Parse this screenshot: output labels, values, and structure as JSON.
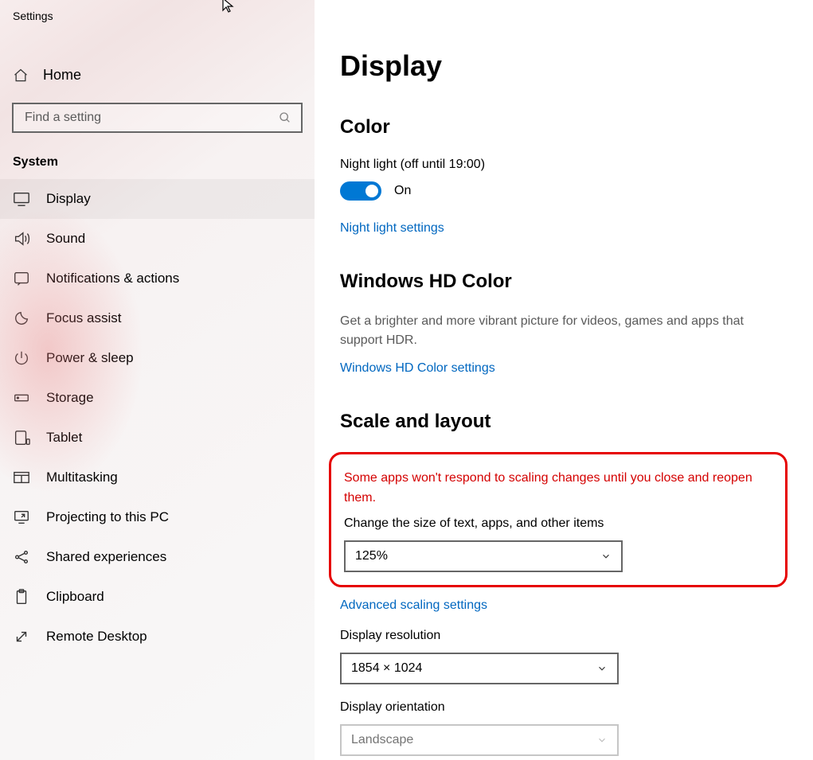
{
  "app_title": "Settings",
  "home_label": "Home",
  "search": {
    "placeholder": "Find a setting"
  },
  "section_title": "System",
  "nav": [
    {
      "icon": "display",
      "label": "Display",
      "selected": true
    },
    {
      "icon": "sound",
      "label": "Sound"
    },
    {
      "icon": "notifications",
      "label": "Notifications & actions"
    },
    {
      "icon": "focus",
      "label": "Focus assist"
    },
    {
      "icon": "power",
      "label": "Power & sleep"
    },
    {
      "icon": "storage",
      "label": "Storage"
    },
    {
      "icon": "tablet",
      "label": "Tablet"
    },
    {
      "icon": "multitasking",
      "label": "Multitasking"
    },
    {
      "icon": "projecting",
      "label": "Projecting to this PC"
    },
    {
      "icon": "shared",
      "label": "Shared experiences"
    },
    {
      "icon": "clipboard",
      "label": "Clipboard"
    },
    {
      "icon": "remote",
      "label": "Remote Desktop"
    }
  ],
  "main": {
    "page_title": "Display",
    "color": {
      "heading": "Color",
      "night_light_label": "Night light (off until 19:00)",
      "toggle_text": "On",
      "link": "Night light settings"
    },
    "hdcolor": {
      "heading": "Windows HD Color",
      "desc": "Get a brighter and more vibrant picture for videos, games and apps that support HDR.",
      "link": "Windows HD Color settings"
    },
    "scale": {
      "heading": "Scale and layout",
      "warning": "Some apps won't respond to scaling changes until you close and reopen them.",
      "change_size_label": "Change the size of text, apps, and other items",
      "scale_value": "125%",
      "advanced_link": "Advanced scaling settings",
      "resolution_label": "Display resolution",
      "resolution_value": "1854 × 1024",
      "orientation_label": "Display orientation",
      "orientation_value": "Landscape"
    }
  }
}
